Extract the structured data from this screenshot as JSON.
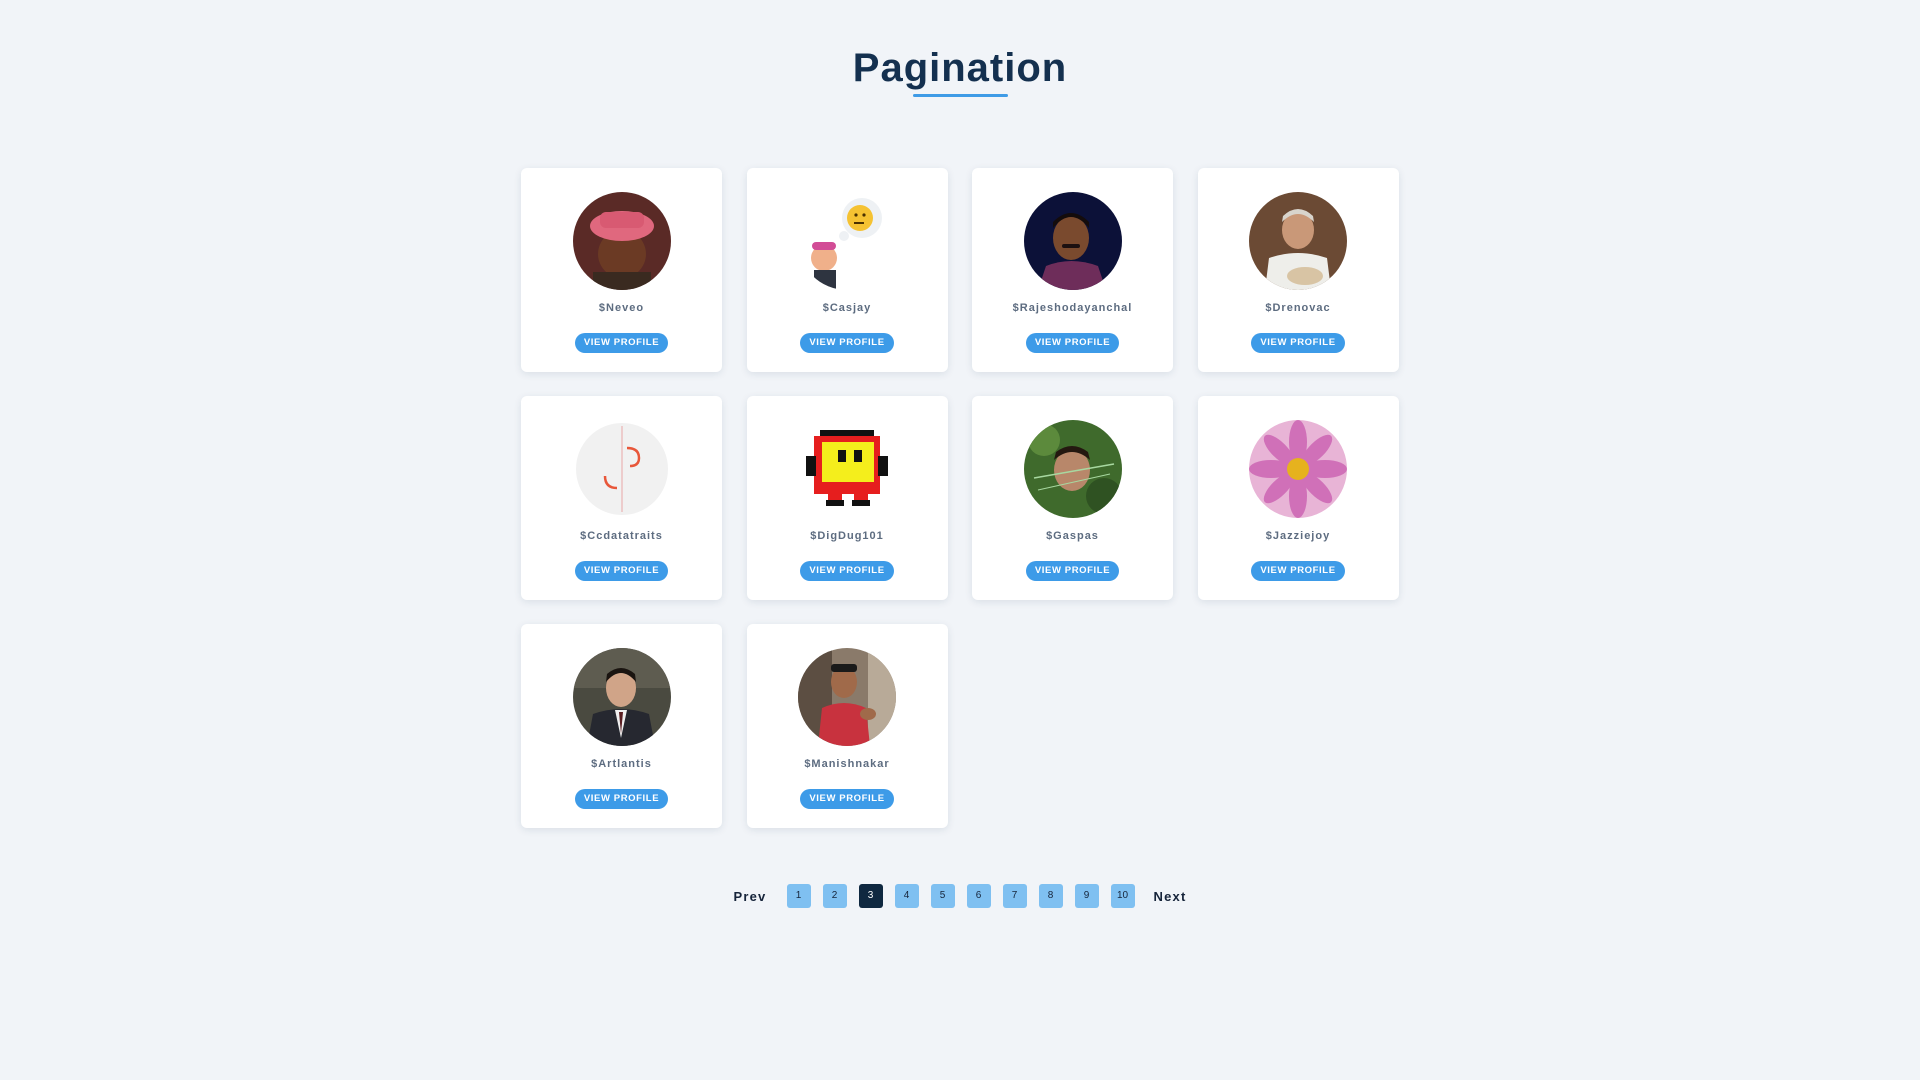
{
  "header": {
    "title": "Pagination"
  },
  "profiles": [
    {
      "name": "$Neveo",
      "button": "VIEW PROFILE",
      "avatar_icon": "person-pink-hat-avatar"
    },
    {
      "name": "$Casjay",
      "button": "VIEW PROFILE",
      "avatar_icon": "cartoon-thinking-emoji-avatar"
    },
    {
      "name": "$Rajeshodayanchal",
      "button": "VIEW PROFILE",
      "avatar_icon": "person-mustache-avatar"
    },
    {
      "name": "$Drenovac",
      "button": "VIEW PROFILE",
      "avatar_icon": "person-white-shirt-avatar"
    },
    {
      "name": "$Ccdatatraits",
      "button": "VIEW PROFILE",
      "avatar_icon": "data-logo-avatar"
    },
    {
      "name": "$DigDug101",
      "button": "VIEW PROFILE",
      "avatar_icon": "pixel-character-avatar"
    },
    {
      "name": "$Gaspas",
      "button": "VIEW PROFILE",
      "avatar_icon": "person-grass-avatar"
    },
    {
      "name": "$Jazziejoy",
      "button": "VIEW PROFILE",
      "avatar_icon": "pink-flower-avatar"
    },
    {
      "name": "$Artlantis",
      "button": "VIEW PROFILE",
      "avatar_icon": "person-suit-avatar"
    },
    {
      "name": "$Manishnakar",
      "button": "VIEW PROFILE",
      "avatar_icon": "person-red-shirt-avatar"
    }
  ],
  "pagination": {
    "prev": "Prev",
    "next": "Next",
    "pages": [
      "1",
      "2",
      "3",
      "4",
      "5",
      "6",
      "7",
      "8",
      "9",
      "10"
    ],
    "current": "3"
  },
  "colors": {
    "background": "#f1f4f8",
    "title": "#14304f",
    "accent": "#3d9be8",
    "page_button": "#7fc0f1",
    "page_button_active": "#0f2840"
  }
}
